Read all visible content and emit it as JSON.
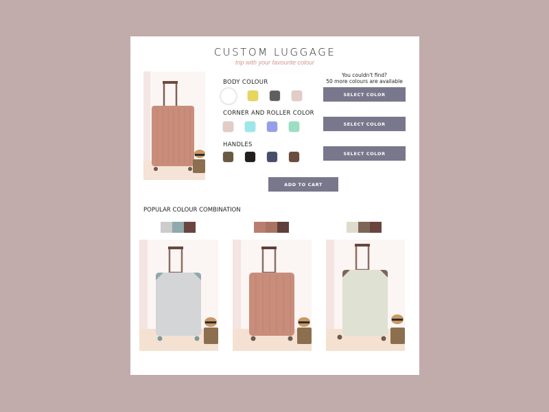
{
  "header": {
    "title": "CUSTOM LUGGAGE",
    "subtitle": "trip with your favourite colour"
  },
  "hero": {
    "icon": "suitcase-image",
    "body_color": "#c98d7c"
  },
  "options": {
    "hint_line1": "You couldn't find?",
    "hint_line2": "50 more colours are available",
    "sections": [
      {
        "label": "BODY COLOUR",
        "swatches": [
          "#ffffff",
          "#e8d55a",
          "#5f5f5f",
          "#e3cbc6"
        ],
        "selected": 0,
        "button": "SELECT COLOR"
      },
      {
        "label": "CORNER AND ROLLER COLOR",
        "swatches": [
          "#e3cbc6",
          "#9be8ea",
          "#949fe8",
          "#9adfc3"
        ],
        "button": "SELECT COLOR"
      },
      {
        "label": "HANDLES",
        "swatches": [
          "#6a5843",
          "#231e1b",
          "#474e6c",
          "#6a4d3f"
        ],
        "button": "SELECT COLOR"
      }
    ],
    "add_to_cart": "ADD TO CART"
  },
  "popular": {
    "label": "POPULAR COLOUR COMBINATION",
    "combos": [
      {
        "colors": [
          "#cccccc",
          "#8fa9ad",
          "#6a4540"
        ],
        "body": "#d3d5d6",
        "corners": "#8fa9ad"
      },
      {
        "colors": [
          "#b97e6e",
          "#a97364",
          "#5e3f3a"
        ],
        "body": "#c98d7c",
        "corners": "#c98d7c"
      },
      {
        "colors": [
          "#dedccc",
          "#7d6657",
          "#6a4540"
        ],
        "body": "#dfe1d3",
        "corners": "#7d6657"
      }
    ]
  },
  "colors": {
    "background": "#c1abab",
    "card": "#ffffff",
    "button": "#79778b",
    "accent_text": "#d09a8e"
  }
}
